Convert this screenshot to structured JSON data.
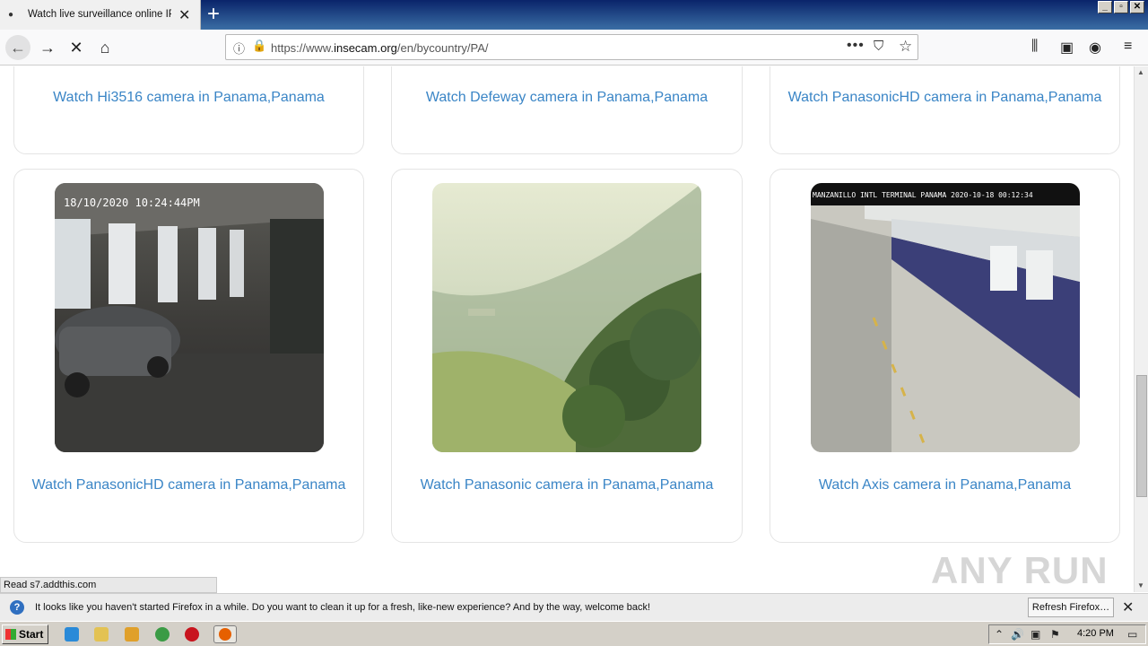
{
  "browser": {
    "tab_title": "Watch live surveillance online IP ca",
    "url_prefix": "https://www.",
    "url_domain": "insecam.org",
    "url_suffix": "/en/bycountry/PA/"
  },
  "cards_top": [
    {
      "label": "Watch Hi3516 camera in Panama,Panama"
    },
    {
      "label": "Watch Defeway camera in Panama,Panama"
    },
    {
      "label": "Watch PanasonicHD camera in Panama,Panama"
    }
  ],
  "cards": [
    {
      "label": "Watch PanasonicHD camera in Panama,Panama",
      "overlay": "18/10/2020  10:24:44PM"
    },
    {
      "label": "Watch Panasonic camera in Panama,Panama",
      "overlay": ""
    },
    {
      "label": "Watch Axis camera in Panama,Panama",
      "overlay": "MANZANILLO INTL TERMINAL PANAMA 2020-10-18 00:12:34"
    }
  ],
  "status_text": "Read s7.addthis.com",
  "notification": {
    "message": "It looks like you haven't started Firefox in a while. Do you want to clean it up for a fresh, like-new experience? And by the way, welcome back!",
    "button": "Refresh Firefox…"
  },
  "taskbar": {
    "start_label": "Start",
    "clock": "4:20 PM"
  },
  "watermark": "ANY RUN"
}
